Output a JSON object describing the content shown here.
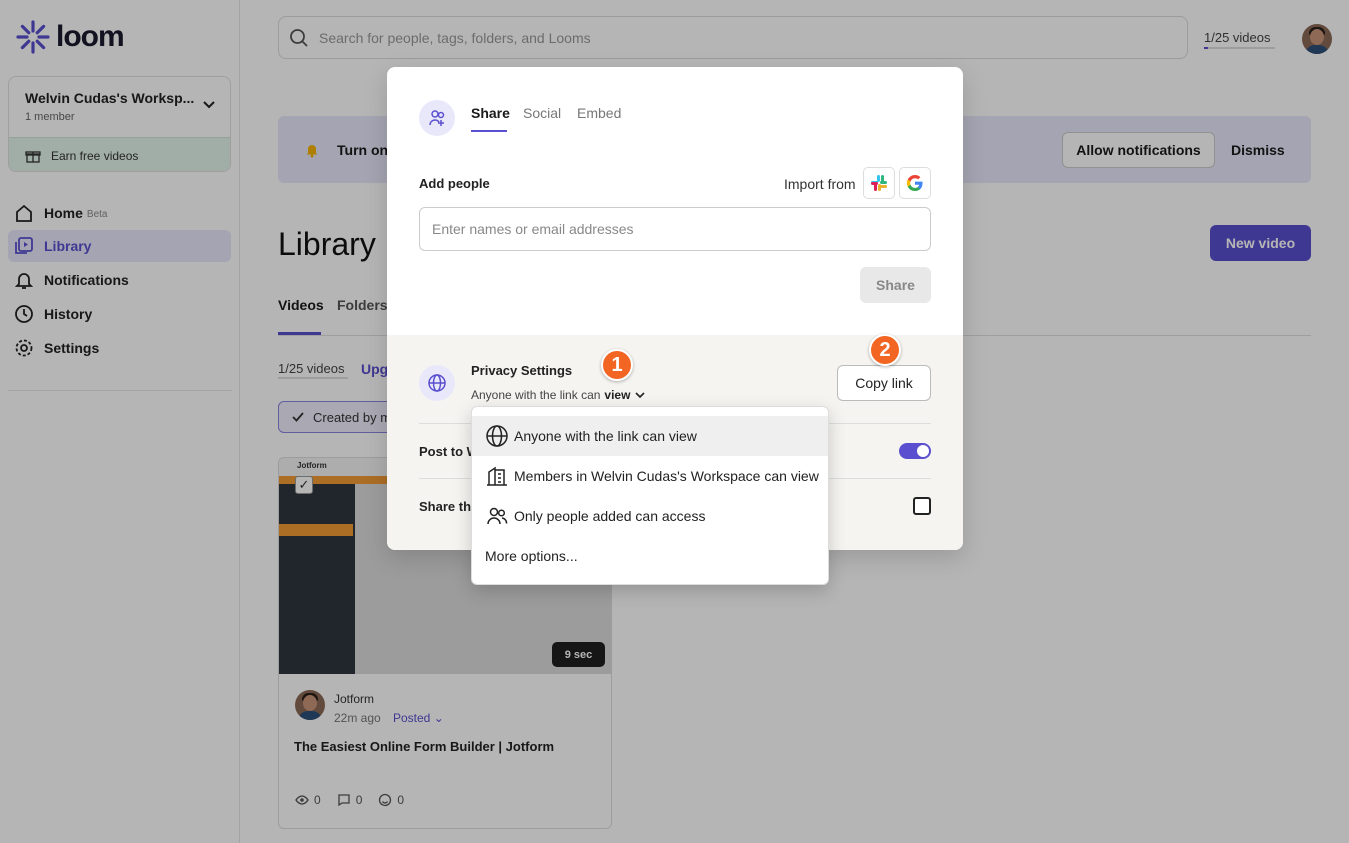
{
  "app": {
    "name": "loom"
  },
  "sidebar": {
    "workspace_name": "Welvin Cudas's Worksp...",
    "workspace_members": "1 member",
    "earn_label": "Earn free videos",
    "items": [
      {
        "label": "Home",
        "badge": "Beta"
      },
      {
        "label": "Library"
      },
      {
        "label": "Notifications"
      },
      {
        "label": "History"
      },
      {
        "label": "Settings"
      }
    ]
  },
  "header": {
    "search_placeholder": "Search for people, tags, folders, and Looms",
    "video_count": "1/25 videos"
  },
  "banner": {
    "text": "Turn on",
    "allow_label": "Allow notifications",
    "dismiss_label": "Dismiss"
  },
  "library": {
    "title": "Library",
    "new_video_label": "New video",
    "tabs": [
      "Videos",
      "Folders"
    ],
    "video_count": "1/25 videos",
    "upgrade": "Upg",
    "filter_label": "Created by m"
  },
  "card": {
    "thumb_brand": "Jotform",
    "duration": "9 sec",
    "author": "Jotform",
    "time": "22m ago",
    "status": "Posted",
    "title": "The Easiest Online Form Builder | Jotform",
    "views": "0",
    "comments": "0",
    "reactions": "0"
  },
  "modal": {
    "tabs": [
      "Share",
      "Social",
      "Embed"
    ],
    "add_people_label": "Add people",
    "import_from_label": "Import from",
    "invite_placeholder": "Enter names or email addresses",
    "share_label": "Share",
    "privacy_title": "Privacy Settings",
    "privacy_sub_prefix": "Anyone with the link can",
    "privacy_sub_level": "view",
    "copy_link_label": "Copy link",
    "post_to_label": "Post to W",
    "share_the_label": "Share th",
    "post_toggle_on": true
  },
  "dropdown": {
    "items": [
      "Anyone with the link can view",
      "Members in Welvin Cudas's Workspace can view",
      "Only people added can access",
      "More options..."
    ]
  },
  "badges": [
    "1",
    "2"
  ],
  "colors": {
    "accent": "#5a4fcf",
    "badge": "#f26522",
    "earn_bg": "#e3f4ec"
  }
}
